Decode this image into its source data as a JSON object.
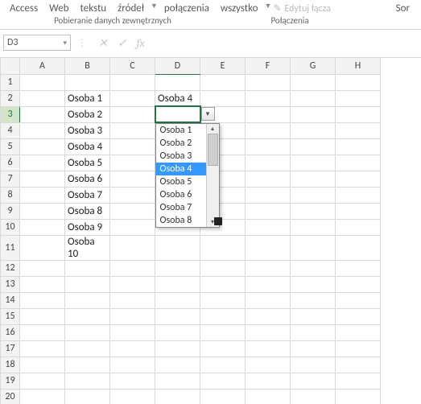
{
  "ribbon": {
    "buttons": [
      "Access",
      "Web",
      "tekstu",
      "źródeł",
      "połączenia",
      "wszystko"
    ],
    "editLinks": "Edytuj łącza",
    "sort": "Sor",
    "group_external": "Pobieranie danych zewnętrznych",
    "group_connections": "Połączenia"
  },
  "namebox": {
    "ref": "D3"
  },
  "formula": {
    "value": ""
  },
  "columns": [
    "A",
    "B",
    "C",
    "D",
    "E",
    "F",
    "G",
    "H"
  ],
  "rows": [
    "1",
    "2",
    "3",
    "4",
    "5",
    "6",
    "7",
    "8",
    "9",
    "10",
    "11",
    "12",
    "13",
    "14",
    "15",
    "16",
    "17",
    "18",
    "19",
    "20"
  ],
  "cells": {
    "B2": "Osoba 1",
    "B3": "Osoba 2",
    "B4": "Osoba 3",
    "B5": "Osoba 4",
    "B6": "Osoba 5",
    "B7": "Osoba 6",
    "B8": "Osoba 7",
    "B9": "Osoba 8",
    "B10": "Osoba 9",
    "B11": "Osoba 10",
    "D2": "Osoba 4"
  },
  "active": {
    "col": "D",
    "row": "3"
  },
  "dropdown": {
    "options": [
      "Osoba 1",
      "Osoba 2",
      "Osoba 3",
      "Osoba 4",
      "Osoba 5",
      "Osoba 6",
      "Osoba 7",
      "Osoba 8"
    ],
    "selected": "Osoba 4"
  },
  "icons": {
    "chevron_down": "▾",
    "cross": "✕",
    "check": "✓",
    "fx": "fx",
    "triangle_up": "▴",
    "triangle_down": "▾",
    "small_down": "▼",
    "pencil": "✎"
  }
}
